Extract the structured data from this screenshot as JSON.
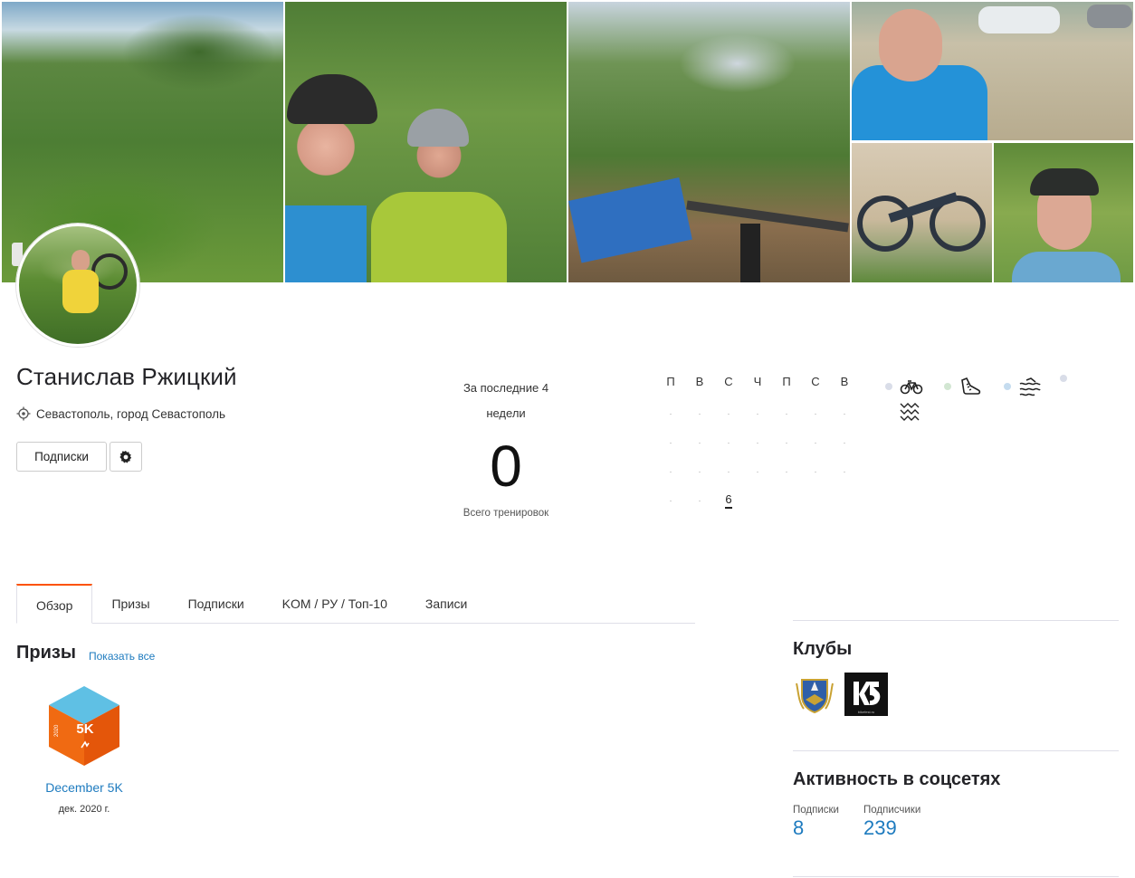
{
  "profile": {
    "name": "Станислав Ржицкий",
    "location": "Севастополь, город Севастополь",
    "subscribe_label": "Подписки"
  },
  "stats": {
    "label_line1": "За последние 4",
    "label_line2": "недели",
    "value": "0",
    "sub_label": "Всего тренировок"
  },
  "calendar": {
    "weekdays": [
      "П",
      "В",
      "С",
      "Ч",
      "П",
      "С",
      "В"
    ],
    "dot": "·",
    "today": "6"
  },
  "sports": [
    "bike-icon",
    "shoe-icon",
    "swim-icon",
    "other-activity-icon"
  ],
  "tabs": [
    "Обзор",
    "Призы",
    "Подписки",
    "KOM / РУ / Топ-10",
    "Записи"
  ],
  "trophies": {
    "title": "Призы",
    "show_all": "Показать все",
    "badge": {
      "year": "2020",
      "label": "5K",
      "name": "December 5K",
      "date": "дек. 2020 г."
    }
  },
  "clubs": {
    "title": "Клубы",
    "club2_tag": "bikefest.ru"
  },
  "social": {
    "title": "Активность в соцсетях",
    "following_label": "Подписки",
    "following_count": "8",
    "followers_label": "Подписчики",
    "followers_count": "239"
  },
  "colors": {
    "accent": "#fc5200",
    "link": "#1e7bbf"
  }
}
